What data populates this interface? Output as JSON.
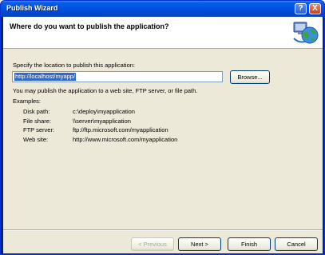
{
  "window": {
    "title": "Publish Wizard"
  },
  "titlebar": {
    "help_glyph": "?",
    "close_glyph": "X"
  },
  "header": {
    "title": "Where do you want to publish the application?",
    "icon": "globe-computer-icon"
  },
  "location": {
    "label": "Specify the location to publish this application:",
    "value": "http://localhost/myapp/",
    "browse_label": "Browse..."
  },
  "description": "You may publish the application to a web site, FTP server, or file path.",
  "examples": {
    "label": "Examples:",
    "rows": [
      {
        "key": "Disk path:",
        "value": "c:\\deploy\\myapplication"
      },
      {
        "key": "File share:",
        "value": "\\\\server\\myapplication"
      },
      {
        "key": "FTP server:",
        "value": "ftp://ftp.microsoft.com/myapplication"
      },
      {
        "key": "Web site:",
        "value": "http://www.microsoft.com/myapplication"
      }
    ]
  },
  "buttons": {
    "previous": "< Previous",
    "next": "Next >",
    "finish": "Finish",
    "cancel": "Cancel"
  }
}
